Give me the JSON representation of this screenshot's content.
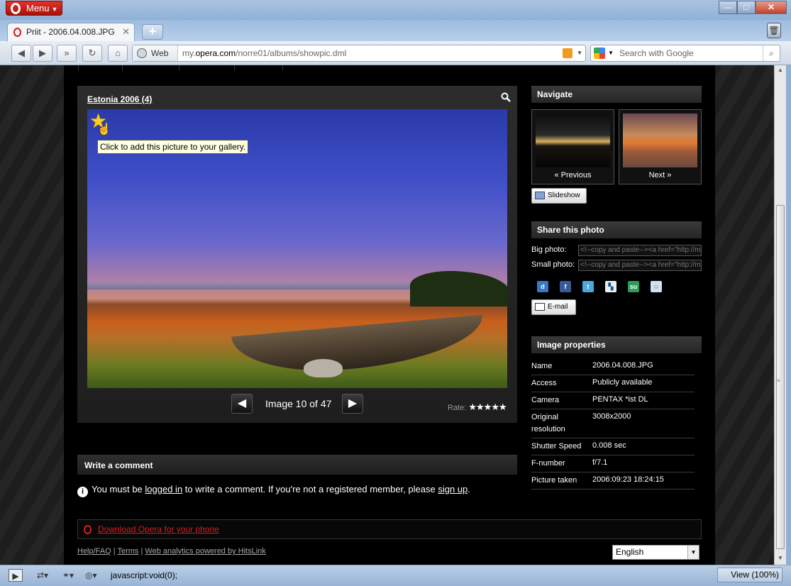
{
  "browser": {
    "menu_label": "Menu",
    "tab_title": "Priit - 2006.04.008.JPG",
    "address_mode": "Web",
    "url_prefix": "my.",
    "url_domain": "opera.com",
    "url_path": "/norre01/albums/showpic.dml",
    "search_placeholder": "Search with Google",
    "status_text": "javascript:void(0);",
    "view_zoom": "View (100%)"
  },
  "photo": {
    "album_link": "Estonia 2006 (4)",
    "tooltip": "Click to add this picture to your gallery.",
    "counter": "Image 10 of 47",
    "rate_label": "Rate:",
    "rate_stars": "★★★★★"
  },
  "navigate": {
    "heading": "Navigate",
    "previous_label": "« Previous",
    "next_label": "Next »",
    "slideshow_label": "Slideshow"
  },
  "share": {
    "heading": "Share this photo",
    "big_label": "Big photo:",
    "big_value": "<!--copy and paste--><a href=\"http://my.opera.com",
    "small_label": "Small photo:",
    "small_value": "<!--copy and paste--><a href=\"http://my.opera.com",
    "email_label": "E-mail",
    "social_icons": [
      "delicious-icon",
      "facebook-icon",
      "twitter-icon",
      "digg-icon",
      "stumbleupon-icon",
      "reddit-icon"
    ]
  },
  "properties": {
    "heading": "Image properties",
    "rows": [
      {
        "k": "Name",
        "v": "2006.04.008.JPG"
      },
      {
        "k": "Access",
        "v": "Publicly available"
      },
      {
        "k": "Camera",
        "v": "PENTAX *ist DL"
      },
      {
        "k": "Original resolution",
        "v": "3008x2000"
      },
      {
        "k": "Shutter Speed",
        "v": "0.008 sec"
      },
      {
        "k": "F-number",
        "v": "f/7.1"
      },
      {
        "k": "Picture taken",
        "v": "2006:09:23 18:24:15"
      }
    ]
  },
  "comment": {
    "heading": "Write a comment",
    "msg_1": "You must be ",
    "login_link": "logged in",
    "msg_2": " to write a comment. If you're not a registered member, please ",
    "signup_link": "sign up",
    "msg_3": "."
  },
  "footer": {
    "download_link": "Download Opera for your phone",
    "help_link": "Help/FAQ",
    "terms_link": "Terms",
    "analytics_link": "Web analytics powered by HitsLink",
    "language": "English"
  },
  "colors": {
    "opera_red": "#d02020",
    "page_bg": "#000000",
    "panel_bg": "#262626"
  }
}
